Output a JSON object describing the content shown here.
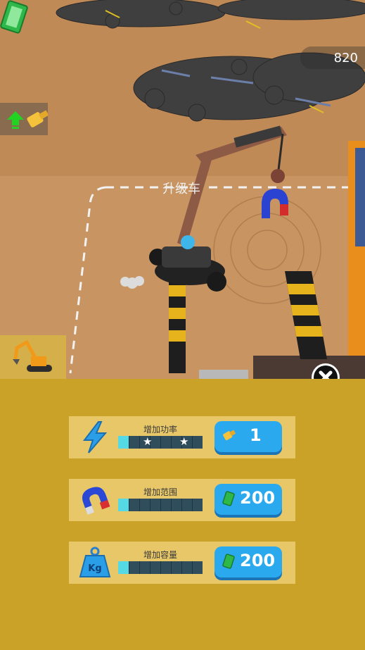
{
  "hud": {
    "money": "820",
    "money_icon": "cash-stack-icon",
    "zone_label": "升级车"
  },
  "side_tabs": [
    {
      "name": "upgrade-tab",
      "icon": "up-arrow-bolt-icon"
    },
    {
      "name": "excavator-tab",
      "icon": "excavator-icon"
    }
  ],
  "panel": {
    "close_icon": "close-icon",
    "upgrades": [
      {
        "icon": "lightning-icon",
        "label": "增加功率",
        "level": 1,
        "stars": 2,
        "cost": "1",
        "currency": "bolt-icon"
      },
      {
        "icon": "magnet-icon",
        "label": "增加范围",
        "level": 1,
        "stars": 0,
        "cost": "200",
        "currency": "cash-icon"
      },
      {
        "icon": "weight-kg-icon",
        "label": "增加容量",
        "level": 1,
        "stars": 0,
        "cost": "200",
        "currency": "cash-icon"
      }
    ],
    "bar_segments": 8
  },
  "colors": {
    "panel_bg": "#c9a227",
    "row_bg": "#e7c768",
    "button": "#2aa9ef",
    "bar_fill": "#55d9e4"
  }
}
